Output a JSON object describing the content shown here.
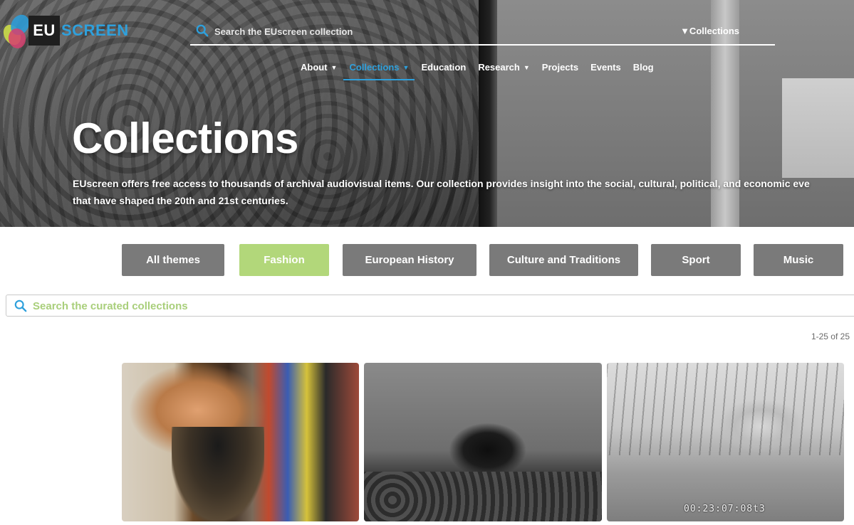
{
  "logo": {
    "eu": "EU",
    "screen": "SCREEN"
  },
  "header": {
    "search_placeholder": "Search the EUscreen collection",
    "search_scope": "▼Collections"
  },
  "nav": {
    "items": [
      {
        "label": "About",
        "has_dropdown": true,
        "active": false
      },
      {
        "label": "Collections",
        "has_dropdown": true,
        "active": true
      },
      {
        "label": "Education",
        "has_dropdown": false,
        "active": false
      },
      {
        "label": "Research",
        "has_dropdown": true,
        "active": false
      },
      {
        "label": "Projects",
        "has_dropdown": false,
        "active": false
      },
      {
        "label": "Events",
        "has_dropdown": false,
        "active": false
      },
      {
        "label": "Blog",
        "has_dropdown": false,
        "active": false
      }
    ]
  },
  "hero": {
    "title": "Collections",
    "description_line1": "EUscreen offers free access to thousands of archival audiovisual items. Our collection provides insight into the social, cultural, political, and economic eve",
    "description_line2": "that have shaped the 20th and 21st centuries."
  },
  "themes": {
    "items": [
      {
        "label": "All themes",
        "active": false
      },
      {
        "label": "Fashion",
        "active": true
      },
      {
        "label": "European History",
        "active": false
      },
      {
        "label": "Culture and Traditions",
        "active": false
      },
      {
        "label": "Sport",
        "active": false
      },
      {
        "label": "Music",
        "active": false
      }
    ]
  },
  "curated_search": {
    "placeholder": "Search the curated collections"
  },
  "results": {
    "count_text": "1-25 of 25"
  },
  "cards": [
    {
      "timecode": ""
    },
    {
      "timecode": ""
    },
    {
      "timecode": "00:23:07:08t3"
    }
  ],
  "colors": {
    "accent_blue": "#2ea0dc",
    "active_theme_green": "#b2d77a",
    "theme_grey": "#7a7a7a",
    "placeholder_green": "#a9cf7b"
  },
  "icons": {
    "search": "search-icon",
    "caret": "caret-down-icon"
  }
}
